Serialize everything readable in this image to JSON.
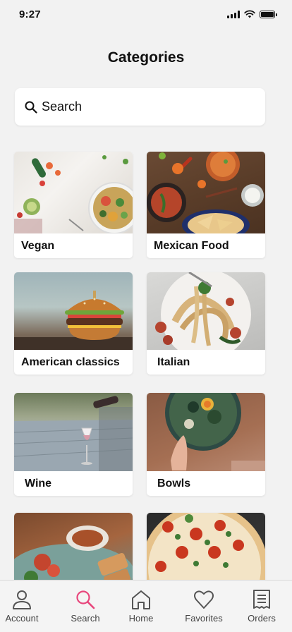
{
  "status_bar": {
    "time": "9:27"
  },
  "header": {
    "title": "Categories"
  },
  "search": {
    "label": "Search"
  },
  "categories": [
    {
      "label": "Vegan"
    },
    {
      "label": "Mexican Food"
    },
    {
      "label": "American classics"
    },
    {
      "label": "Italian"
    },
    {
      "label": "Wine"
    },
    {
      "label": "Bowls"
    },
    {
      "label": ""
    },
    {
      "label": ""
    }
  ],
  "tabbar": {
    "items": [
      {
        "label": "Account",
        "icon": "person-icon"
      },
      {
        "label": "Search",
        "icon": "search-icon",
        "active": true
      },
      {
        "label": "Home",
        "icon": "home-icon"
      },
      {
        "label": "Favorites",
        "icon": "heart-icon"
      },
      {
        "label": "Orders",
        "icon": "receipt-icon"
      }
    ]
  },
  "colors": {
    "accent": "#e8467c",
    "icon": "#555555",
    "background": "#f2f2f2"
  }
}
